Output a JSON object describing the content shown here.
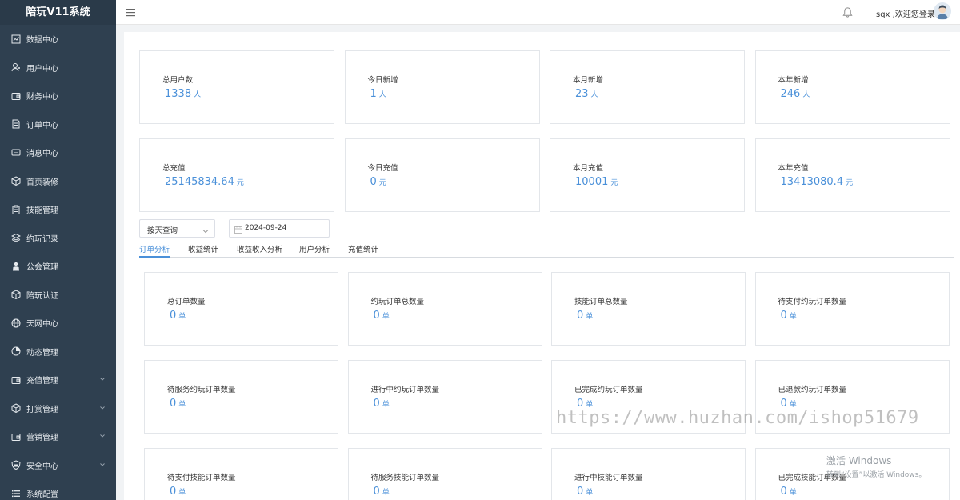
{
  "app": {
    "title": "陪玩V11系统"
  },
  "header": {
    "welcome": "sqx ,欢迎您登录"
  },
  "sidebar": {
    "items": [
      {
        "label": "数据中心",
        "icon": "chart-icon",
        "expandable": false
      },
      {
        "label": "用户中心",
        "icon": "user-icon",
        "expandable": false
      },
      {
        "label": "财务中心",
        "icon": "wallet-icon",
        "expandable": false
      },
      {
        "label": "订单中心",
        "icon": "document-icon",
        "expandable": false
      },
      {
        "label": "消息中心",
        "icon": "message-icon",
        "expandable": false
      },
      {
        "label": "首页装修",
        "icon": "box-icon",
        "expandable": false
      },
      {
        "label": "技能管理",
        "icon": "clipboard-icon",
        "expandable": false
      },
      {
        "label": "约玩记录",
        "icon": "layers-icon",
        "expandable": false
      },
      {
        "label": "公会管理",
        "icon": "person-icon",
        "expandable": false
      },
      {
        "label": "陪玩认证",
        "icon": "box-icon",
        "expandable": false
      },
      {
        "label": "天网中心",
        "icon": "globe-icon",
        "expandable": false
      },
      {
        "label": "动态管理",
        "icon": "pie-icon",
        "expandable": false
      },
      {
        "label": "充值管理",
        "icon": "wallet-icon",
        "expandable": true
      },
      {
        "label": "打赏管理",
        "icon": "box-icon",
        "expandable": true
      },
      {
        "label": "营销管理",
        "icon": "wallet-icon",
        "expandable": true
      },
      {
        "label": "安全中心",
        "icon": "shield-icon",
        "expandable": true
      },
      {
        "label": "系统配置",
        "icon": "list-icon",
        "expandable": false
      }
    ]
  },
  "stats_row1": [
    {
      "label": "总用户数",
      "value": "1338",
      "unit": "人"
    },
    {
      "label": "今日新增",
      "value": "1",
      "unit": "人"
    },
    {
      "label": "本月新增",
      "value": "23",
      "unit": "人"
    },
    {
      "label": "本年新增",
      "value": "246",
      "unit": "人"
    }
  ],
  "stats_row2": [
    {
      "label": "总充值",
      "value": "25145834.64",
      "unit": "元"
    },
    {
      "label": "今日充值",
      "value": "0",
      "unit": "元"
    },
    {
      "label": "本月充值",
      "value": "10001",
      "unit": "元"
    },
    {
      "label": "本年充值",
      "value": "13413080.4",
      "unit": "元"
    }
  ],
  "filters": {
    "query_mode": "按天查询",
    "date": "2024-09-24"
  },
  "tabs": [
    {
      "label": "订单分析",
      "active": true
    },
    {
      "label": "收益统计",
      "active": false
    },
    {
      "label": "收益收入分析",
      "active": false
    },
    {
      "label": "用户分析",
      "active": false
    },
    {
      "label": "充值统计",
      "active": false
    }
  ],
  "order_stats": [
    {
      "label": "总订单数量",
      "value": "0",
      "unit": "单"
    },
    {
      "label": "约玩订单总数量",
      "value": "0",
      "unit": "单"
    },
    {
      "label": "技能订单总数量",
      "value": "0",
      "unit": "单"
    },
    {
      "label": "待支付约玩订单数量",
      "value": "0",
      "unit": "单"
    },
    {
      "label": "待服务约玩订单数量",
      "value": "0",
      "unit": "单"
    },
    {
      "label": "进行中约玩订单数量",
      "value": "0",
      "unit": "单"
    },
    {
      "label": "已完成约玩订单数量",
      "value": "0",
      "unit": "单"
    },
    {
      "label": "已退款约玩订单数量",
      "value": "0",
      "unit": "单"
    },
    {
      "label": "待支付技能订单数量",
      "value": "0",
      "unit": "单"
    },
    {
      "label": "待服务技能订单数量",
      "value": "0",
      "unit": "单"
    },
    {
      "label": "进行中技能订单数量",
      "value": "0",
      "unit": "单"
    },
    {
      "label": "已完成技能订单数量",
      "value": "0",
      "unit": "单"
    }
  ],
  "watermarks": {
    "url": "https://www.huzhan.com/ishop51679",
    "os_line1": "激活 Windows",
    "os_line2": "转到“设置”以激活 Windows。"
  },
  "colors": {
    "sidebar_bg": "#2f4050",
    "accent": "#4a90d9",
    "content_bg": "#f1f3f5"
  }
}
